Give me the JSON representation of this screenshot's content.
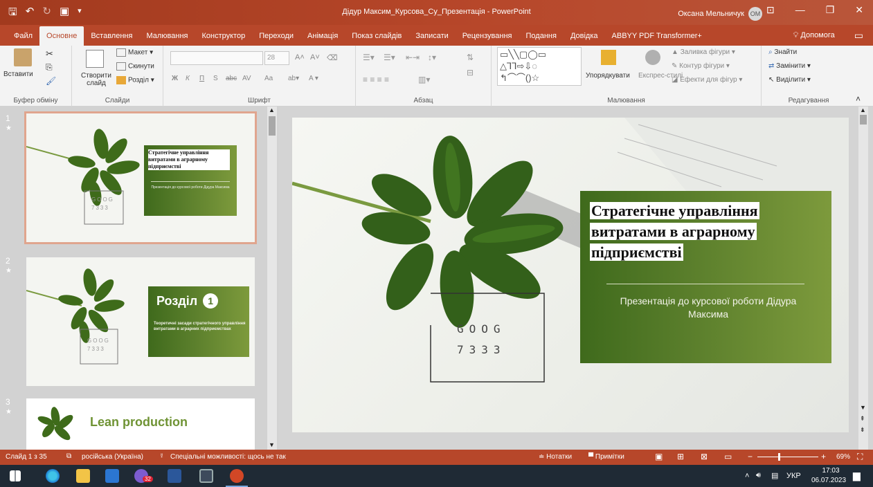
{
  "window": {
    "document_title": "Дідур Максим_Курсова_Су_Презентація - PowerPoint",
    "user_name": "Оксана Мельничук",
    "user_initials": "ОМ"
  },
  "tabs": [
    {
      "label": "Файл"
    },
    {
      "label": "Основне"
    },
    {
      "label": "Вставлення"
    },
    {
      "label": "Малювання"
    },
    {
      "label": "Конструктор"
    },
    {
      "label": "Переходи"
    },
    {
      "label": "Анімація"
    },
    {
      "label": "Показ слайдів"
    },
    {
      "label": "Записати"
    },
    {
      "label": "Рецензування"
    },
    {
      "label": "Подання"
    },
    {
      "label": "Довідка"
    },
    {
      "label": "ABBYY PDF Transformer+"
    }
  ],
  "help_label": "Допомога",
  "ribbon": {
    "clipboard": {
      "paste": "Вставити",
      "label": "Буфер обміну"
    },
    "slides": {
      "new_slide": "Створити слайд",
      "layout": "Макет",
      "reset": "Скинути",
      "section": "Розділ",
      "label": "Слайди"
    },
    "font": {
      "size": "28",
      "bold": "Ж",
      "italic": "К",
      "underline": "П",
      "shadow": "S",
      "strike": "abc",
      "spacing": "AV",
      "case": "Aa",
      "label": "Шрифт"
    },
    "paragraph": {
      "label": "Абзац"
    },
    "drawing": {
      "arrange": "Упорядкувати",
      "quick_styles": "Експрес-стилі",
      "fill": "Заливка фігури",
      "outline": "Контур фігури",
      "effects": "Ефекти для фігур",
      "label": "Малювання"
    },
    "editing": {
      "find": "Знайти",
      "replace": "Замінити",
      "select": "Виділити",
      "label": "Редагування"
    }
  },
  "thumbnails": [
    {
      "num": "1",
      "star": "★",
      "title": "Стратегічне управління витратами в аграрному підприємстві",
      "subtitle": "Презентація до курсової роботи Дідура Максима",
      "code1": "GOOG",
      "code2": "7333"
    },
    {
      "num": "2",
      "star": "★",
      "section": "Розділ",
      "badge": "1",
      "text": "Теоретичні засади стратегічного управління витратами в аграрних підприємствах",
      "code1": "GOOG",
      "code2": "7333"
    },
    {
      "num": "3",
      "star": "★",
      "title": "Lean production"
    }
  ],
  "slide": {
    "title": "Стратегічне управління витратами в аграрному підприємстві",
    "subtitle": "Презентація до курсової роботи Дідура Максима",
    "code1": "GOOG",
    "code2": "7333"
  },
  "status": {
    "slide_counter": "Слайд 1 з 35",
    "language": "російська (Україна)",
    "accessibility": "Спеціальні можливості: щось не так",
    "notes": "Нотатки",
    "comments": "Примітки",
    "zoom": "69%"
  },
  "taskbar": {
    "lang": "УКР",
    "time": "17:03",
    "date": "06.07.2023",
    "badge": "32"
  },
  "colors": {
    "accent": "#b7472a",
    "slide_green": "#4f7424"
  }
}
